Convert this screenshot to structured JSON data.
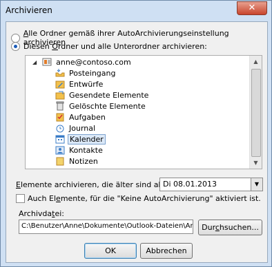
{
  "window": {
    "title": "Archivieren",
    "close_glyph": "✕"
  },
  "options": {
    "all_folders": {
      "pre": "",
      "accel": "A",
      "post": "lle Ordner gemäß ihrer AutoArchivierungseinstellung archivieren",
      "checked": false
    },
    "this_folder": {
      "pre": "Diesen ",
      "accel": "O",
      "post": "rdner und alle Unterordner archivieren:",
      "checked": true
    }
  },
  "tree": {
    "root": {
      "label": "anne@contoso.com",
      "expander": "◢"
    },
    "items": [
      {
        "label": "Posteingang",
        "icon": "inbox-icon"
      },
      {
        "label": "Entwürfe",
        "icon": "drafts-icon"
      },
      {
        "label": "Gesendete Elemente",
        "icon": "sent-items-icon"
      },
      {
        "label": "Gelöschte Elemente",
        "icon": "deleted-items-icon"
      },
      {
        "label": "Aufgaben",
        "icon": "tasks-icon"
      },
      {
        "label": "Journal",
        "icon": "journal-icon"
      },
      {
        "label": "Kalender",
        "icon": "calendar-icon",
        "selected": true
      },
      {
        "label": "Kontakte",
        "icon": "contacts-icon"
      },
      {
        "label": "Notizen",
        "icon": "notes-icon"
      }
    ]
  },
  "older_than": {
    "pre": "",
    "accel": "E",
    "post": "lemente archivieren, die älter sind als:",
    "value": "Di 08.01.2013"
  },
  "include_no_archive": {
    "pre": "Auch El",
    "accel": "e",
    "post": "mente, für die \"Keine AutoArchivierung\" aktiviert ist.",
    "checked": false
  },
  "archive_file": {
    "pre": "Archivda",
    "accel": "t",
    "post": "ei:",
    "path": "C:\\Benutzer\\Anne\\Dokumente\\Outlook-Dateien\\Archiv"
  },
  "buttons": {
    "browse": {
      "pre": "Dur",
      "accel": "c",
      "post": "hsuchen..."
    },
    "ok": "OK",
    "cancel": "Abbrechen"
  },
  "colors": {
    "accent": "#1a5bb8",
    "selected_bg": "#dbe8f7",
    "close_red": "#c8452d"
  }
}
